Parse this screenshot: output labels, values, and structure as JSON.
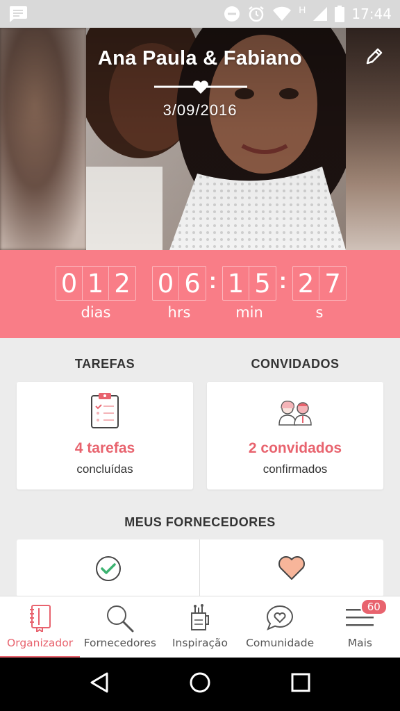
{
  "status_bar": {
    "time": "17:44",
    "icons": [
      "notification-message-icon",
      "do-not-disturb-icon",
      "alarm-icon",
      "wifi-icon",
      "h-network-icon",
      "signal-icon",
      "battery-icon"
    ],
    "network_letter": "H"
  },
  "hero": {
    "couple_names": "Ana Paula & Fabiano",
    "wedding_date": "3/09/2016",
    "edit_icon": "pencil-icon"
  },
  "countdown": {
    "days": [
      "0",
      "1",
      "2"
    ],
    "hours": [
      "0",
      "6"
    ],
    "minutes": [
      "1",
      "5"
    ],
    "seconds": [
      "2",
      "7"
    ],
    "labels": {
      "days": "dias",
      "hours": "hrs",
      "minutes": "min",
      "seconds": "s"
    },
    "separator": ":"
  },
  "tasks": {
    "title": "TAREFAS",
    "count_text": "4 tarefas",
    "status_text": "concluídas",
    "icon": "clipboard-checklist-icon"
  },
  "guests": {
    "title": "CONVIDADOS",
    "count_text": "2 convidados",
    "status_text": "confirmados",
    "icon": "couple-icon"
  },
  "vendors": {
    "title": "MEUS FORNECEDORES",
    "left_icon": "checkmark-circle-icon",
    "right_icon": "heart-icon"
  },
  "bottom_nav": {
    "items": [
      {
        "label": "Organizador",
        "icon": "notebook-icon",
        "active": true
      },
      {
        "label": "Fornecedores",
        "icon": "search-icon",
        "active": false
      },
      {
        "label": "Inspiração",
        "icon": "inspiration-cup-icon",
        "active": false
      },
      {
        "label": "Comunidade",
        "icon": "chat-heart-icon",
        "active": false
      },
      {
        "label": "Mais",
        "icon": "menu-icon",
        "active": false
      }
    ],
    "badge_count": "60"
  },
  "colors": {
    "accent": "#e8636e",
    "countdown_bg": "#f97d87",
    "page_bg": "#ececec",
    "vendor_heart": "#f7b59a"
  }
}
